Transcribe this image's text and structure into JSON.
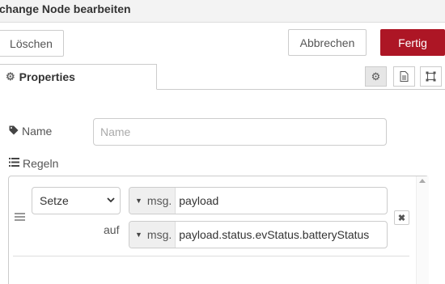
{
  "dialog": {
    "title": "change Node bearbeiten"
  },
  "toolbar": {
    "delete_label": "Löschen",
    "cancel_label": "Abbrechen",
    "done_label": "Fertig"
  },
  "tabs": [
    {
      "label": "Properties",
      "icon": "gear-icon"
    }
  ],
  "tab_tools": [
    {
      "icon": "gear-icon"
    },
    {
      "icon": "document-icon"
    },
    {
      "icon": "frame-icon"
    }
  ],
  "form": {
    "name_label": "Name",
    "name_placeholder": "Name",
    "name_value": "",
    "rules_label": "Regeln"
  },
  "rule": {
    "action": "Setze",
    "target_type": "msg.",
    "target_value": "payload",
    "to_label": "auf",
    "source_type": "msg.",
    "source_value": "payload.status.evStatus.batteryStatus"
  },
  "colors": {
    "primary": "#ad1625",
    "border": "#cccccc"
  }
}
